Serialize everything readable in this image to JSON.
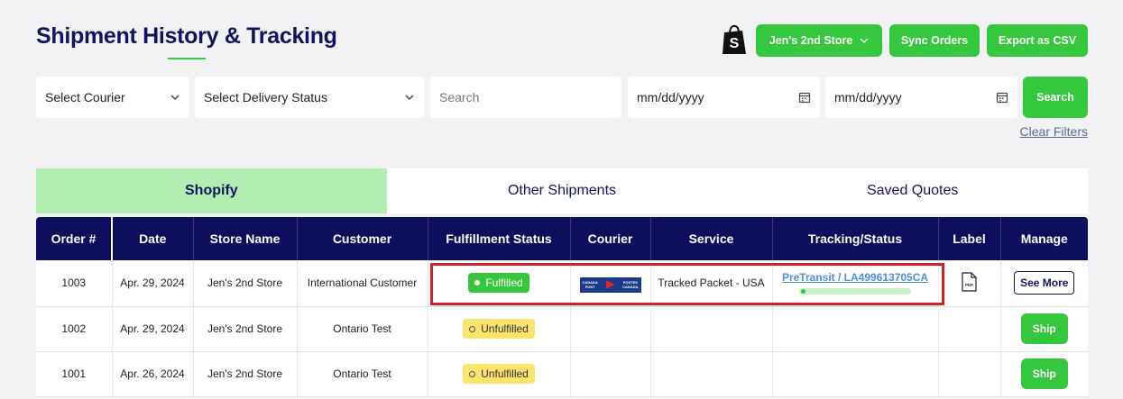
{
  "header": {
    "title": "Shipment History & Tracking",
    "store_button": "Jen's 2nd Store",
    "sync_button": "Sync Orders",
    "export_button": "Export as CSV",
    "brand_color": "#35c83f",
    "navy_color": "#0e0e5e"
  },
  "filters": {
    "courier_placeholder": "Select Courier",
    "status_placeholder": "Select Delivery Status",
    "search_placeholder": "Search",
    "date_from": "mm/dd/yyyy",
    "date_to": "mm/dd/yyyy",
    "search_button": "Search",
    "clear_filters": "Clear Filters"
  },
  "tabs": [
    {
      "label": "Shopify",
      "active": true
    },
    {
      "label": "Other Shipments",
      "active": false
    },
    {
      "label": "Saved Quotes",
      "active": false
    }
  ],
  "table": {
    "columns": [
      "Order #",
      "Date",
      "Store Name",
      "Customer",
      "Fulfillment Status",
      "Courier",
      "Service",
      "Tracking/Status",
      "Label",
      "Manage"
    ],
    "rows": [
      {
        "order": "1003",
        "date": "Apr. 29, 2024",
        "store": "Jen's 2nd Store",
        "customer": "International Customer",
        "fulfillment": "Fulfilled",
        "courier_logo": "canada-post-logo",
        "courier_text": "CANADA POST POSTES CANADA",
        "service": "Tracked Packet - USA",
        "tracking": "PreTransit / LA499613705CA",
        "label_icon": "pdf-icon",
        "manage": "See More"
      },
      {
        "order": "1002",
        "date": "Apr. 29, 2024",
        "store": "Jen's 2nd Store",
        "customer": "Ontario Test",
        "fulfillment": "Unfulfilled",
        "manage": "Ship"
      },
      {
        "order": "1001",
        "date": "Apr. 26, 2024",
        "store": "Jen's 2nd Store",
        "customer": "Ontario Test",
        "fulfillment": "Unfulfilled",
        "manage": "Ship"
      }
    ]
  }
}
